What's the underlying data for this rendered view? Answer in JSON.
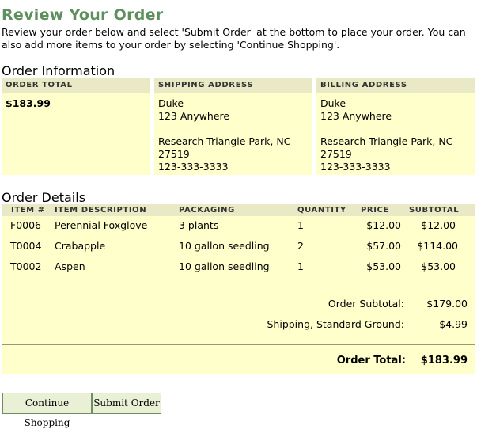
{
  "page": {
    "title": "Review Your Order",
    "intro": "Review your order below and select 'Submit Order' at the bottom to place your order. You can also add more items to your order by selecting 'Continue Shopping'."
  },
  "order_information": {
    "heading": "Order Information",
    "order_total": {
      "label": "ORDER TOTAL",
      "value": "$183.99"
    },
    "shipping_address": {
      "label": "SHIPPING ADDRESS",
      "name": "Duke",
      "street": "123 Anywhere",
      "street2": "",
      "city_state": "Research Triangle Park, NC",
      "zip": "27519",
      "phone": "123-333-3333"
    },
    "billing_address": {
      "label": "BILLING ADDRESS",
      "name": "Duke",
      "street": "123 Anywhere",
      "street2": "",
      "city_state": "Research Triangle Park, NC",
      "zip": "27519",
      "phone": "123-333-3333"
    }
  },
  "order_details": {
    "heading": "Order Details",
    "columns": {
      "item": "ITEM #",
      "description": "ITEM DESCRIPTION",
      "packaging": "PACKAGING",
      "quantity": "QUANTITY",
      "price": "PRICE",
      "subtotal": "SUBTOTAL"
    },
    "rows": [
      {
        "item": "F0006",
        "description": "Perennial Foxglove",
        "packaging": "3 plants",
        "quantity": "1",
        "price": "$12.00",
        "subtotal": "$12.00"
      },
      {
        "item": "T0004",
        "description": "Crabapple",
        "packaging": "10 gallon seedling",
        "quantity": "2",
        "price": "$57.00",
        "subtotal": "$114.00"
      },
      {
        "item": "T0002",
        "description": "Aspen",
        "packaging": "10 gallon seedling",
        "quantity": "1",
        "price": "$53.00",
        "subtotal": "$53.00"
      }
    ],
    "summary": {
      "subtotal_label": "Order Subtotal:",
      "subtotal_value": "$179.00",
      "shipping_label": "Shipping, Standard Ground:",
      "shipping_value": "$4.99",
      "total_label": "Order Total:",
      "total_value": "$183.99"
    }
  },
  "buttons": {
    "continue_shopping": "Continue Shopping",
    "submit_order": "Submit Order"
  },
  "colors": {
    "title_green": "#5f8f5f",
    "panel_background": "#ffffcc",
    "header_background": "#e9e9c5",
    "button_background": "#eaf0d6",
    "button_border": "#6f8f5f"
  }
}
